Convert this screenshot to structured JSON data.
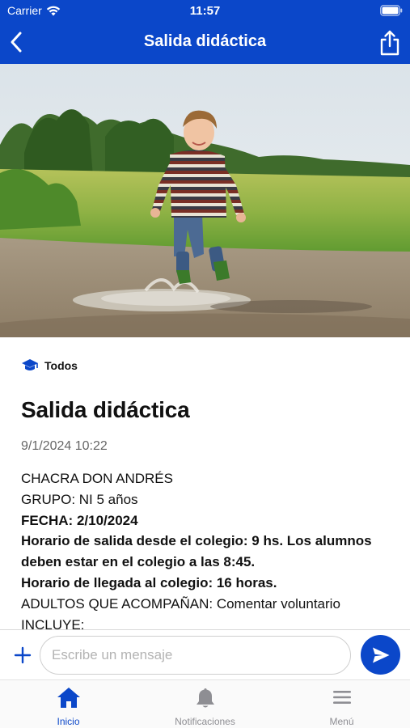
{
  "status_bar": {
    "carrier": "Carrier",
    "time": "11:57"
  },
  "nav": {
    "title": "Salida didáctica"
  },
  "post": {
    "audience": "Todos",
    "title": "Salida didáctica",
    "date": "9/1/2024 10:22",
    "lines": [
      {
        "text": "CHACRA DON ANDRÉS"
      },
      {
        "text": "GRUPO: NI 5 años"
      },
      {
        "label": "FECHA:",
        "text": " 2/10/2024"
      },
      {
        "label": "Horario de salida desde el colegio: 9 hs. Los alumnos deben estar en el colegio a las 8:45."
      },
      {
        "label": "Horario de llegada al colegio: 16 horas."
      },
      {
        "text": "ADULTOS QUE ACOMPAÑAN: Comentar voluntario"
      },
      {
        "text": "INCLUYE:"
      }
    ]
  },
  "composer": {
    "placeholder": "Escribe un mensaje"
  },
  "tabbar": {
    "items": [
      {
        "label": "Inicio",
        "active": true
      },
      {
        "label": "Notificaciones",
        "active": false
      },
      {
        "label": "Menú",
        "active": false
      }
    ]
  },
  "colors": {
    "brand": "#0b47c9",
    "tab_inactive": "#8e8e93"
  }
}
